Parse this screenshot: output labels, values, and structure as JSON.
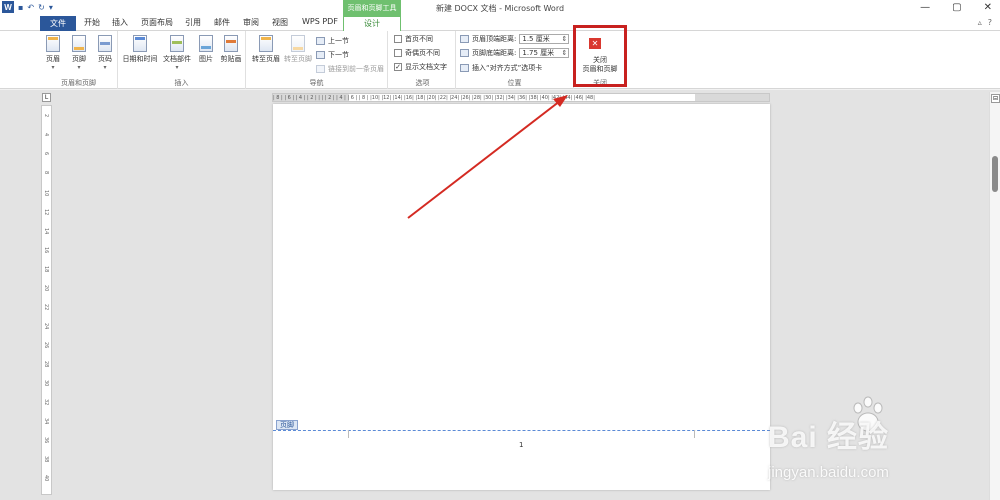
{
  "window": {
    "title": "新建 DOCX 文档 - Microsoft Word",
    "context_tab_header": "页眉和页脚工具",
    "logo_letter": "W",
    "qat": [
      "▪",
      "↶",
      "↻",
      "▾"
    ],
    "controls": [
      "—",
      "▢",
      "✕"
    ]
  },
  "tabs": {
    "file": "文件",
    "items": [
      "开始",
      "插入",
      "页面布局",
      "引用",
      "邮件",
      "审阅",
      "视图",
      "WPS PDF"
    ],
    "active": "设计",
    "right": [
      "▵",
      "?"
    ]
  },
  "ribbon": {
    "header_footer": {
      "label": "页眉和页脚",
      "buttons": [
        "页眉",
        "页脚",
        "页码"
      ]
    },
    "insert": {
      "label": "插入",
      "buttons": [
        "日期和时间",
        "文档部件",
        "图片",
        "剪贴画"
      ]
    },
    "navigation": {
      "label": "导航",
      "goto_header": "转至页眉",
      "goto_footer": "转至页脚",
      "prev": "上一节",
      "next": "下一节",
      "link_prev": "链接到前一条页眉"
    },
    "options": {
      "label": "选项",
      "first_page": "首页不同",
      "odd_even": "奇偶页不同",
      "show_text": "显示文档文字",
      "show_text_checked": "✓"
    },
    "position": {
      "label": "位置",
      "header_dist_label": "页眉顶端距离:",
      "header_dist_value": "1.5 厘米",
      "footer_dist_label": "页脚底端距离:",
      "footer_dist_value": "1.75 厘米",
      "align_tab": "插入“对齐方式”选项卡"
    },
    "close": {
      "label": "关闭",
      "icon": "✕",
      "button_line1": "关闭",
      "button_line2": "页眉和页脚"
    }
  },
  "ruler": {
    "corner": "L",
    "h_ticks": "| 8 |   | 6 |   | 4 |   | 2 |   |   |   | 2 |   | 4 |   | 6 |   | 8 |   |10|   |12|   |14|   |16|   |18|   |20|   |22|   |24|   |26|   |28|   |30|   |32|   |34|   |36|   |38|   |40|   |42|   |44|   |46|   |48|",
    "v_numbers": [
      "2",
      "4",
      "6",
      "8",
      "10",
      "12",
      "14",
      "16",
      "18",
      "20",
      "22",
      "24",
      "26",
      "28",
      "30",
      "32",
      "34",
      "36",
      "38",
      "40"
    ]
  },
  "document": {
    "footer_tag": "页脚",
    "page_number": "1"
  },
  "scroll": {
    "top_icon": "⊟"
  },
  "watermark": {
    "brand": "Bai  经验",
    "url": "jingyan.baidu.com"
  },
  "colors": {
    "word_blue": "#2b579a",
    "context_green": "#6fc06f",
    "highlight_red": "#c8211f"
  }
}
